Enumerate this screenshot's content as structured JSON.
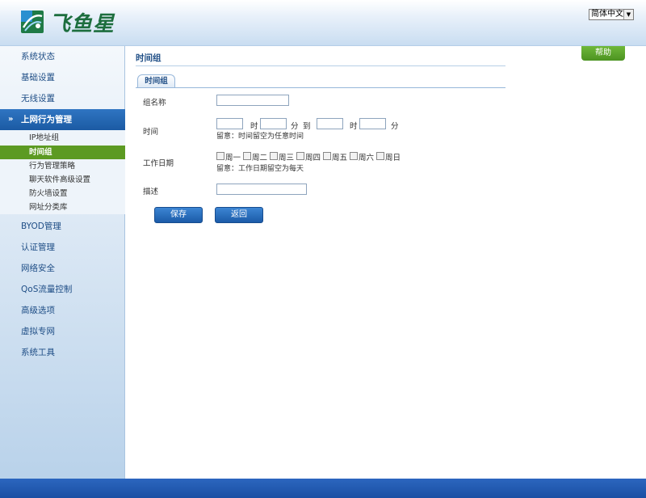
{
  "header": {
    "brand": "飞鱼星",
    "language": "简体中文"
  },
  "sidebar": {
    "items": [
      {
        "label": "系统状态"
      },
      {
        "label": "基础设置"
      },
      {
        "label": "无线设置"
      },
      {
        "label": "上网行为管理"
      },
      {
        "label": "BYOD管理"
      },
      {
        "label": "认证管理"
      },
      {
        "label": "网络安全"
      },
      {
        "label": "QoS流量控制"
      },
      {
        "label": "高级选项"
      },
      {
        "label": "虚拟专网"
      },
      {
        "label": "系统工具"
      }
    ],
    "subitems": [
      {
        "label": "IP地址组"
      },
      {
        "label": "时间组"
      },
      {
        "label": "行为管理策略"
      },
      {
        "label": "聊天软件高级设置"
      },
      {
        "label": "防火墙设置"
      },
      {
        "label": "网址分类库"
      }
    ]
  },
  "main": {
    "title": "时间组",
    "help": "帮助",
    "tab": "时间组",
    "form": {
      "group_name_label": "组名称",
      "group_name_value": "",
      "time_label": "时间",
      "hour_unit": "时",
      "minute_unit": "分",
      "to_word": "到",
      "time_note": "留意：时间留空为任意时间",
      "workday_label": "工作日期",
      "days": [
        "周一",
        "周二",
        "周三",
        "周四",
        "周五",
        "周六",
        "周日"
      ],
      "workday_note": "留意：工作日期留空为每天",
      "desc_label": "描述",
      "desc_value": ""
    },
    "buttons": {
      "save": "保存",
      "back": "返回"
    }
  }
}
